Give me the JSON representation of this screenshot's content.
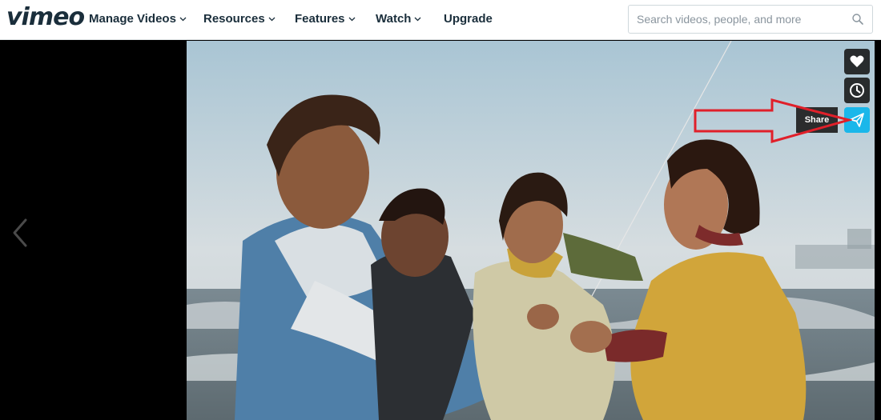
{
  "header": {
    "logo": "vimeo",
    "nav": [
      {
        "label": "Manage Videos",
        "has_dropdown": true
      },
      {
        "label": "Resources",
        "has_dropdown": true
      },
      {
        "label": "Features",
        "has_dropdown": true
      },
      {
        "label": "Watch",
        "has_dropdown": true
      },
      {
        "label": "Upgrade",
        "has_dropdown": false
      }
    ],
    "search": {
      "placeholder": "Search videos, people, and more",
      "value": ""
    }
  },
  "player": {
    "side_buttons": [
      {
        "name": "like",
        "icon": "heart-icon"
      },
      {
        "name": "watch-later",
        "icon": "clock-icon"
      },
      {
        "name": "share",
        "icon": "paper-plane-icon"
      }
    ],
    "tooltip": "Share",
    "prev_icon": "chevron-left-icon"
  },
  "colors": {
    "brand": "#1a2e3b",
    "share_accent": "#1ab7ea",
    "annotation_arrow": "#e0202a"
  }
}
